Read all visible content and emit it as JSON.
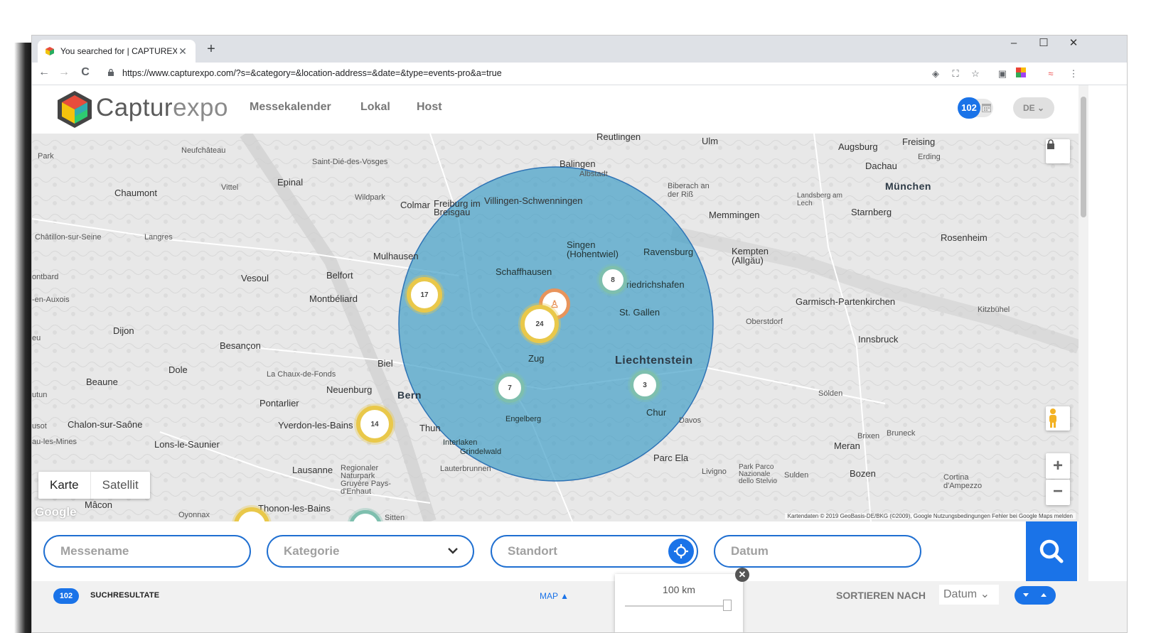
{
  "browser": {
    "tab_title": "You searched for | CAPTUREXPO",
    "tab_close": "✕",
    "new_tab": "+",
    "url": "https://www.capturexpo.com/?s=&category=&location-address=&date=&type=events-pro&a=true",
    "controls": {
      "minimize": "–",
      "maximize": "☐",
      "close": "✕"
    },
    "nav": {
      "back": "←",
      "forward": "→",
      "reload": "C"
    }
  },
  "site": {
    "brand_dark": "Captur",
    "brand_light": "expo",
    "nav": [
      "Messekalender",
      "Lokal",
      "Host"
    ],
    "count": "102",
    "language": "DE ⌄"
  },
  "map": {
    "labels": {
      "park": "Park",
      "neufchateau": "Neufchâteau",
      "saint_die": "Saint-Dié-des-Vosges",
      "reutlingen": "Reutlingen",
      "ulm": "Ulm",
      "augsburg": "Augsburg",
      "freising": "Freising",
      "balingen": "Balingen",
      "albstadt": "Albstadt",
      "dachau": "Dachau",
      "erding": "Erding",
      "muenchen": "München",
      "chaumont": "Chaumont",
      "vittel": "Vittel",
      "epinal": "Epinal",
      "wildpark": "Wildpark",
      "colmar": "Colmar",
      "freiburg": "Freiburg im Breisgau",
      "villingen": "Villingen-Schwenningen",
      "biberach": "Biberach an der Riß",
      "memmingen": "Memmingen",
      "landsberg": "Landsberg am Lech",
      "starnberg": "Starnberg",
      "chatillon": "Châtillon-sur-Seine",
      "langres": "Langres",
      "mulhausen": "Mulhausen",
      "singen": "Singen (Hohentwiel)",
      "ravensburg": "Ravensburg",
      "kempten": "Kempten (Allgäu)",
      "rosenheim": "Rosenheim",
      "vesoul": "Vesoul",
      "belfort": "Belfort",
      "schaffhausen": "Schaffhausen",
      "friedrichshafen": "Friedrichshafen",
      "garmisch": "Garmisch-Partenkirchen",
      "montbeliard": "Montbéliard",
      "st_gallen": "St. Gallen",
      "oberstdorf": "Oberstdorf",
      "kufstein_like": "Kitzbühel",
      "dijon": "Dijon",
      "besancon": "Besançon",
      "zug": "Zug",
      "innsbruck": "Innsbruck",
      "liechtenstein": "Liechtenstein",
      "dole": "Dole",
      "biel": "Biel",
      "chaux": "La Chaux-de-Fonds",
      "beaune": "Beaune",
      "neuenburg": "Neuenburg",
      "bern": "Bern",
      "pontarlier": "Pontarlier",
      "solden": "Sölden",
      "yverdon": "Yverdon-les-Bains",
      "chalon": "Chalon-sur-Saône",
      "davos": "Davos",
      "chur": "Chur",
      "engelberg": "Engelberg",
      "lons": "Lons-le-Saunier",
      "thun": "Thun",
      "interlaken": "Interlaken",
      "grindelwald": "Grindelwald",
      "meran": "Meran",
      "bruneck": "Bruneck",
      "brixen": "Brixen",
      "parc_ela": "Parc Ela",
      "lausanne": "Lausanne",
      "naturpark": "Regionaler Naturpark Gruyère Pays-d'Enhaut",
      "lauterbrunnen": "Lauterbrunnen",
      "bozen": "Bozen",
      "cortina": "Cortina d'Ampezzo",
      "macon": "Mâcon",
      "thonon": "Thonon-les-Bains",
      "sitten": "Sitten",
      "oyonnax": "Oyonnax",
      "livigno": "Livigno",
      "sulden": "Sulden",
      "stelvio": "Park Parco Nazionale dello Stelvio",
      "eu": "eu",
      "tutun": "utun",
      "usot": "usot",
      "mines": "au-les-Mines",
      "auxois": "-en-Auxois",
      "ontbard": "ontbard"
    },
    "clusters": [
      {
        "id": "c17",
        "count": "17"
      },
      {
        "id": "c8",
        "count": "8"
      },
      {
        "id": "c24",
        "count": "24"
      },
      {
        "id": "c7",
        "count": "7"
      },
      {
        "id": "c3",
        "count": "3"
      },
      {
        "id": "c14",
        "count": "14"
      }
    ],
    "type_map": "Karte",
    "type_satellite": "Satellit",
    "zoom_in": "+",
    "zoom_out": "−",
    "google": "Google",
    "attribution": "Kartendaten © 2019 GeoBasis-DE/BKG (©2009), Google   Nutzungsbedingungen   Fehler bei Google Maps melden",
    "circle_color": "#3d9cc6"
  },
  "search": {
    "name_placeholder": "Messename",
    "category_placeholder": "Kategorie",
    "location_placeholder": "Standort",
    "date_placeholder": "Datum"
  },
  "radius": {
    "value": "100 km",
    "close": "✕",
    "slider_fraction": 1.0
  },
  "results": {
    "count": "102",
    "label": "SUCHRESULTATE",
    "map_link": "MAP ▲",
    "sort_label": "SORTIEREN NACH",
    "sort_value": "Datum ⌄"
  },
  "colors": {
    "accent": "#1a73e8",
    "cluster_yellow": "#e9c84a",
    "cluster_teal": "#7ebfae"
  }
}
